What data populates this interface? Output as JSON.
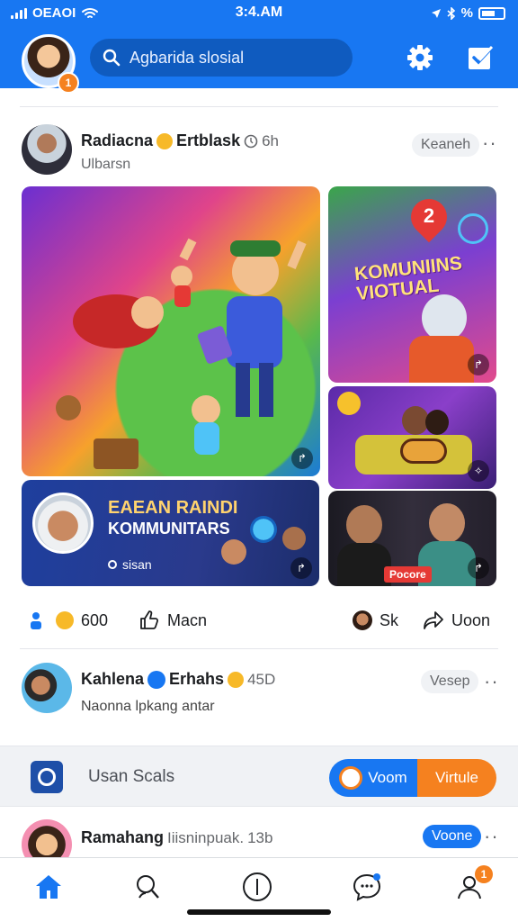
{
  "status_bar": {
    "carrier": "OEAOI",
    "time": "3:4.AM",
    "battery_label": "%"
  },
  "header": {
    "avatar_badge": "1",
    "search_placeholder": "Agbarida slosial"
  },
  "post1": {
    "author": "Radiacna",
    "author_extra": "Ertblask",
    "time": "6h",
    "subtitle": "Ulbarsn",
    "pill": "Keaneh",
    "tile_banner_title": "EAEAN RAINDI",
    "tile_banner_subtitle": "KOMMUNITARS",
    "tile_banner_meta": "sisan",
    "tile_top_right_text": "KOMUNIINS VIOTUAL",
    "tile_top_right_badge": "2",
    "tile_bottom_right_label": "Pocore",
    "corner_glyph_1": "↱",
    "corner_glyph_2": "↱",
    "corner_glyph_3": "✧",
    "corner_glyph_4": "↱",
    "corner_glyph_5": "↱"
  },
  "actions": {
    "count": "600",
    "like_label": "Macn",
    "share_small": "Sk",
    "share_label": "Uoon"
  },
  "post2": {
    "author": "Kahlena",
    "author_extra": "Erhahs",
    "time": "45D",
    "subtitle": "Naonna lpkang antar",
    "pill": "Vesep"
  },
  "suggest": {
    "label": "Usan Scals",
    "primary_button": "Voom",
    "secondary_button": "Virtule"
  },
  "post3": {
    "author": "Ramahang",
    "author_extra": "Iiisninpuak.",
    "time": "13b",
    "pill": "Voone"
  },
  "bottom_nav": {
    "profile_badge": "1"
  },
  "colors": {
    "brand": "#1877f2",
    "accent": "#f5811f"
  }
}
